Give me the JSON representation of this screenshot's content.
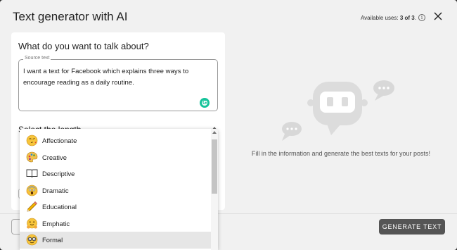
{
  "header": {
    "title": "Text generator with AI",
    "uses_prefix": "Available uses: ",
    "uses_value": "3 of 3",
    "uses_suffix": "."
  },
  "form": {
    "question": "What do you want to talk about?",
    "source_label": "Source text",
    "source_value": "I want a text for Facebook which explains three ways to encourage reading as a daily routine.",
    "length_label": "Select the length"
  },
  "dropdown": {
    "items": [
      {
        "label": "Affectionate",
        "icon": "blowing-kiss-emoji-icon"
      },
      {
        "label": "Creative",
        "icon": "artist-palette-emoji-icon"
      },
      {
        "label": "Descriptive",
        "icon": "open-book-icon"
      },
      {
        "label": "Dramatic",
        "icon": "screaming-face-emoji-icon"
      },
      {
        "label": "Educational",
        "icon": "pencil-icon"
      },
      {
        "label": "Emphatic",
        "icon": "hugging-face-emoji-icon"
      },
      {
        "label": "Formal",
        "icon": "nerd-face-emoji-icon"
      }
    ],
    "selected": "Formal"
  },
  "empty_state": {
    "message": "Fill in the information and generate the best texts for your posts!"
  },
  "footer": {
    "generate_label": "GENERATE TEXT"
  },
  "colors": {
    "primary_button": "#555555",
    "grammarly": "#15c39a",
    "robot_gray": "#dcdcdc"
  }
}
